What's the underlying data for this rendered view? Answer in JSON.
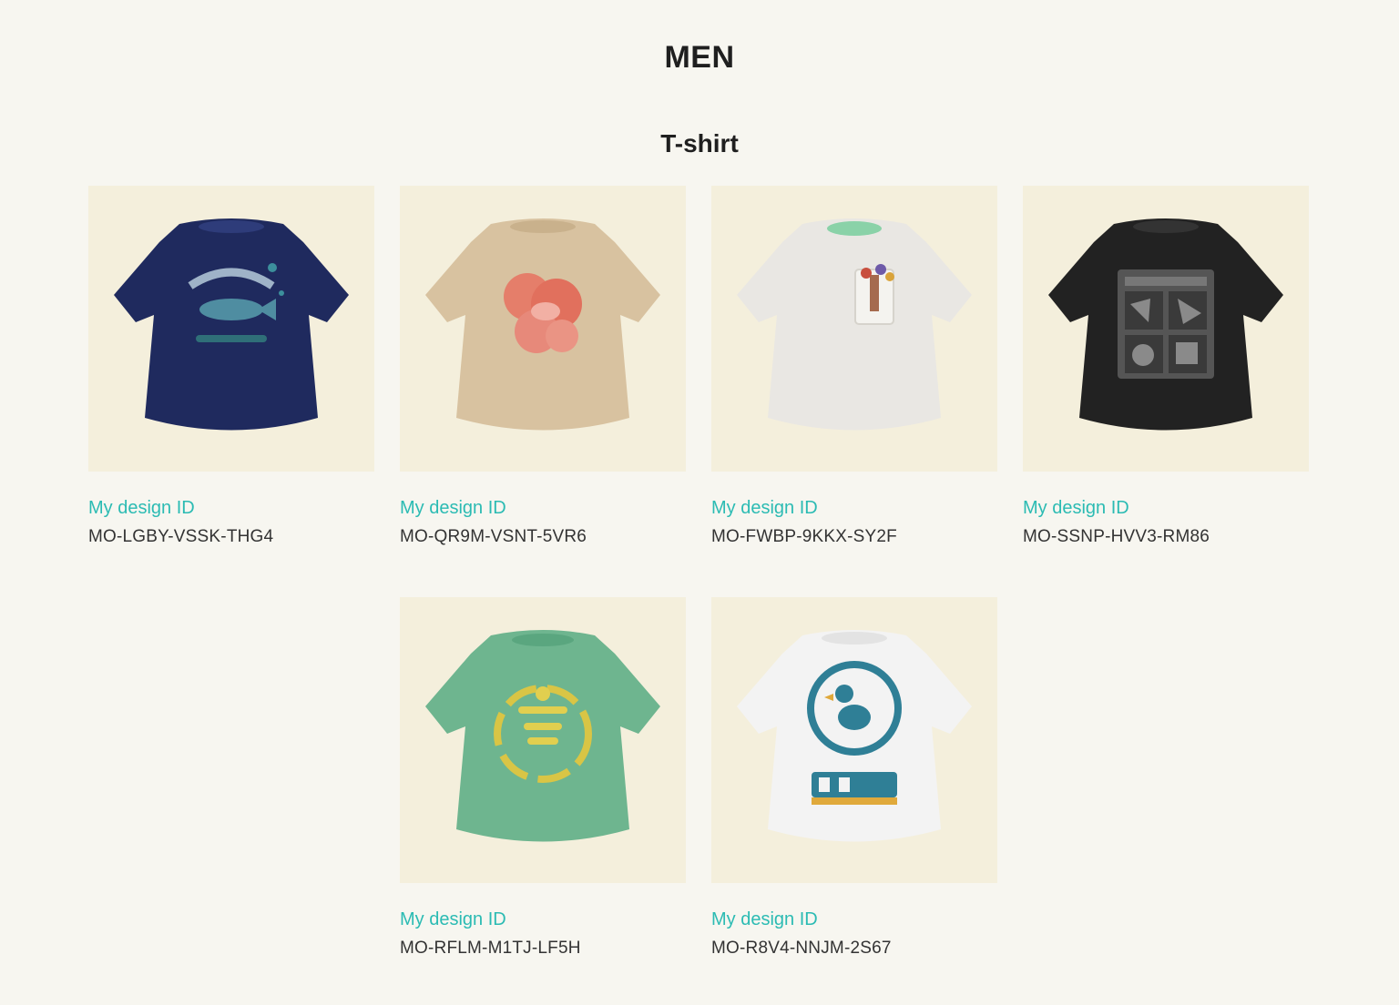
{
  "page": {
    "title": "MEN"
  },
  "section": {
    "title": "T-shirt"
  },
  "items": [
    {
      "label": "My design ID",
      "id": "MO-LGBY-VSSK-THG4",
      "shirt_color": "#1f2a5e",
      "graphic": "fish"
    },
    {
      "label": "My design ID",
      "id": "MO-QR9M-VSNT-5VR6",
      "shirt_color": "#d8c2a0",
      "graphic": "coral-flower"
    },
    {
      "label": "My design ID",
      "id": "MO-FWBP-9KKX-SY2F",
      "shirt_color": "#e9e7e3",
      "graphic": "pocket"
    },
    {
      "label": "My design ID",
      "id": "MO-SSNP-HVV3-RM86",
      "shirt_color": "#222222",
      "graphic": "window-panels"
    },
    {
      "label": "My design ID",
      "id": "MO-RFLM-M1TJ-LF5H",
      "shirt_color": "#6eb58f",
      "graphic": "yellow-emblem"
    },
    {
      "label": "My design ID",
      "id": "MO-R8V4-NNJM-2S67",
      "shirt_color": "#f3f3f3",
      "graphic": "dodo-logo"
    }
  ],
  "colors": {
    "accent": "#2bbbb3",
    "background": "#f7f6f0",
    "thumb_bg": "#f4efdc"
  }
}
